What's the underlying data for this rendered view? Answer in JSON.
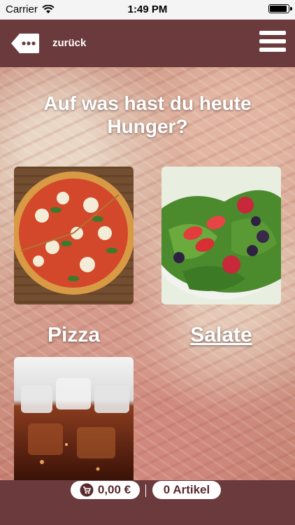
{
  "status_bar": {
    "carrier": "Carrier",
    "time": "1:49 PM"
  },
  "header": {
    "back_label": "zurück"
  },
  "main": {
    "title": "Auf was hast du heute Hunger?",
    "categories": [
      {
        "label": "Pizza"
      },
      {
        "label": "Salate"
      },
      {
        "label": ""
      }
    ]
  },
  "footer": {
    "price": "0,00 €",
    "items": "0 Artikel"
  },
  "colors": {
    "header": "#6b3a3d",
    "accent": "#5a2a2e"
  }
}
